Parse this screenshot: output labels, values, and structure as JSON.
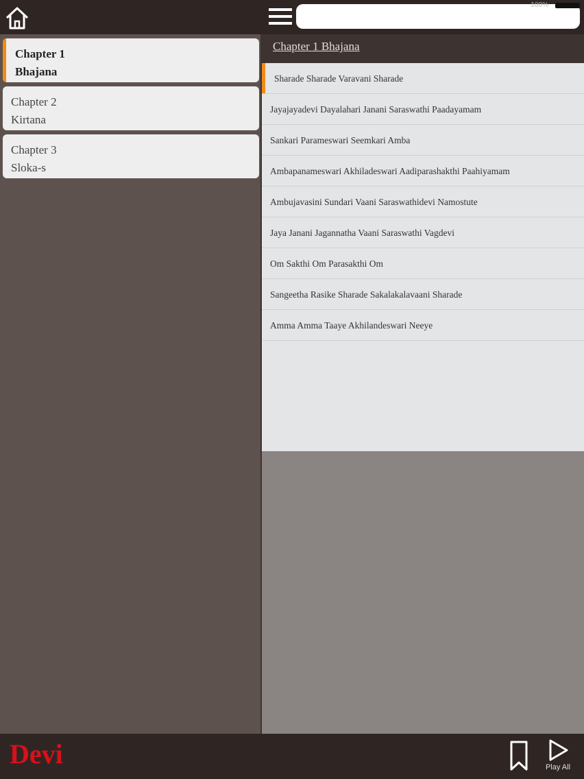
{
  "top": {
    "search_placeholder": "",
    "status_text": "100%"
  },
  "chapters": [
    {
      "title": "Chapter 1",
      "name": "Bhajana",
      "active": true
    },
    {
      "title": "Chapter 2",
      "name": "Kirtana",
      "active": false
    },
    {
      "title": "Chapter 3",
      "name": "Sloka-s",
      "active": false
    }
  ],
  "list_header": "Chapter 1 Bhajana",
  "songs": [
    "Sharade Sharade Varavani Sharade",
    "Jayajayadevi Dayalahari Janani Saraswathi Paadayamam",
    "Sankari Parameswari Seemkari Amba",
    "Ambapanameswari Akhiladeswari Aadiparashakthi Paahiyamam",
    "Ambujavasini Sundari Vaani Saraswathidevi Namostute",
    "Jaya Janani Jagannatha Vaani Saraswathi Vagdevi",
    "Om Sakthi Om Parasakthi Om",
    "Sangeetha Rasike Sharade Sakalakalavaani Sharade",
    "Amma Amma Taaye Akhilandeswari Neeye"
  ],
  "bottom": {
    "brand": "Devi",
    "play_label": "Play All"
  },
  "colors": {
    "accent": "#f28a1a",
    "brand": "#d8101a"
  }
}
